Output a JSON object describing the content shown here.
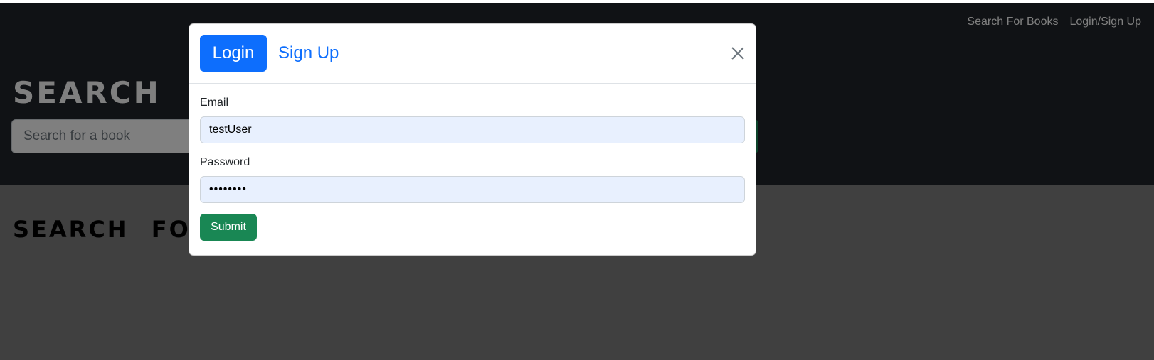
{
  "navbar": {
    "links": [
      "Search For Books",
      "Login/Sign Up"
    ]
  },
  "hero": {
    "title": "SEARCH FOR BOOKS!",
    "search_placeholder": "Search for a book"
  },
  "content": {
    "title": "SEARCH FOR A BOOK TO BEGIN"
  },
  "modal": {
    "tabs": {
      "login": "Login",
      "signup": "Sign Up"
    },
    "email_label": "Email",
    "email_value": "testUser",
    "password_label": "Password",
    "password_value": "••••••••",
    "submit_label": "Submit"
  },
  "colors": {
    "primary": "#0d6efd",
    "success": "#198754",
    "header_bg": "#21252a",
    "autofill_bg": "#e8f0fe"
  },
  "icons": {
    "close": "close-icon"
  }
}
